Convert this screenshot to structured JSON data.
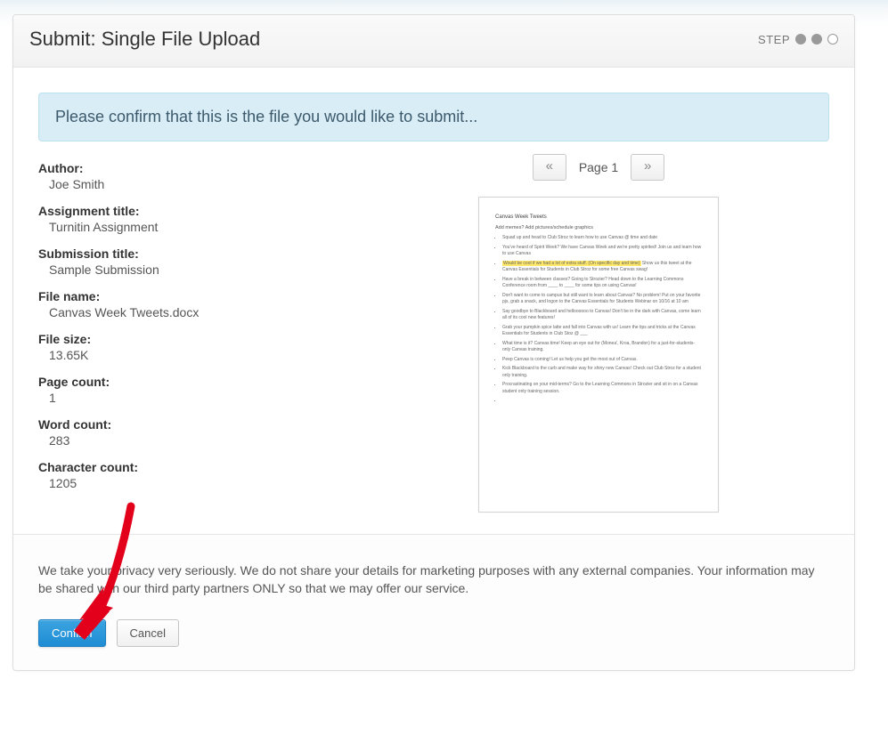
{
  "header": {
    "title": "Submit: Single File Upload",
    "step_label": "STEP"
  },
  "alert": "Please confirm that this is the file you would like to submit...",
  "meta": {
    "author": {
      "label": "Author:",
      "value": "Joe Smith"
    },
    "assignment_title": {
      "label": "Assignment title:",
      "value": "Turnitin Assignment"
    },
    "submission_title": {
      "label": "Submission title:",
      "value": "Sample Submission"
    },
    "file_name": {
      "label": "File name:",
      "value": "Canvas Week Tweets.docx"
    },
    "file_size": {
      "label": "File size:",
      "value": "13.65K"
    },
    "page_count": {
      "label": "Page count:",
      "value": "1"
    },
    "word_count": {
      "label": "Word count:",
      "value": "283"
    },
    "character_count": {
      "label": "Character count:",
      "value": "1205"
    }
  },
  "pager": {
    "prev": "«",
    "label": "Page 1",
    "next": "»"
  },
  "preview": {
    "title": "Canvas Week Tweets",
    "subtitle": "Add memes? Add pictures/schedule graphics",
    "hl": "Would be cool if we had a lot of extra stuff. (On specific day and time)",
    "items": [
      "Squad up and head to Club Stroz to learn how to use Canvas @ time and date",
      "You've heard of Spirit Week? We have Canvas Week and we're pretty spirited! Join us and learn how to use Canvas",
      "Show us this tweet at the Canvas Essentials for Students in Club Stroz for some free Canvas swag!",
      "Have a break in between classes? Going to Strozier?  Head down to the Learning Commons Conference room from ____ to ____ for some tips on using Canvas!",
      "Don't want to come to campus but still want to learn about Canvas? No problem! Put on your favorite pjs, grab a snack, and logon to the Canvas Essentials for Students Webinar on 10/16 at 10 am",
      "Say goodbye to Blackboard and helloooooo to Canvas! Don't be in the dark with Canvas, come learn all of its cool new features!",
      "Grab your pumpkin spice latte and fall into Canvas with us! Learn the tips and tricks at the Canvas Essentials for Students in Club Stoz @ ___",
      "What time is it? Canvas time! Keep an eye out for (Monea', Kroa, Brandon) for a just-for-students-only Canvas training.",
      "Peep Canvas is coming! Let us help you get the most out of Canvas.",
      "Kick Blackboard to the curb and make way for shiny new Canvas! Check out Club Stroz for a student only training.",
      "Procrastinating on your mid-terms? Go to the Learning Commons in Strozier and sit in on a Canvas student only training session."
    ]
  },
  "footer": {
    "privacy": "We take your privacy very seriously. We do not share your details for marketing purposes with any external companies. Your information may be shared with our third party partners ONLY so that we may offer our service.",
    "confirm": "Confirm",
    "cancel": "Cancel"
  }
}
